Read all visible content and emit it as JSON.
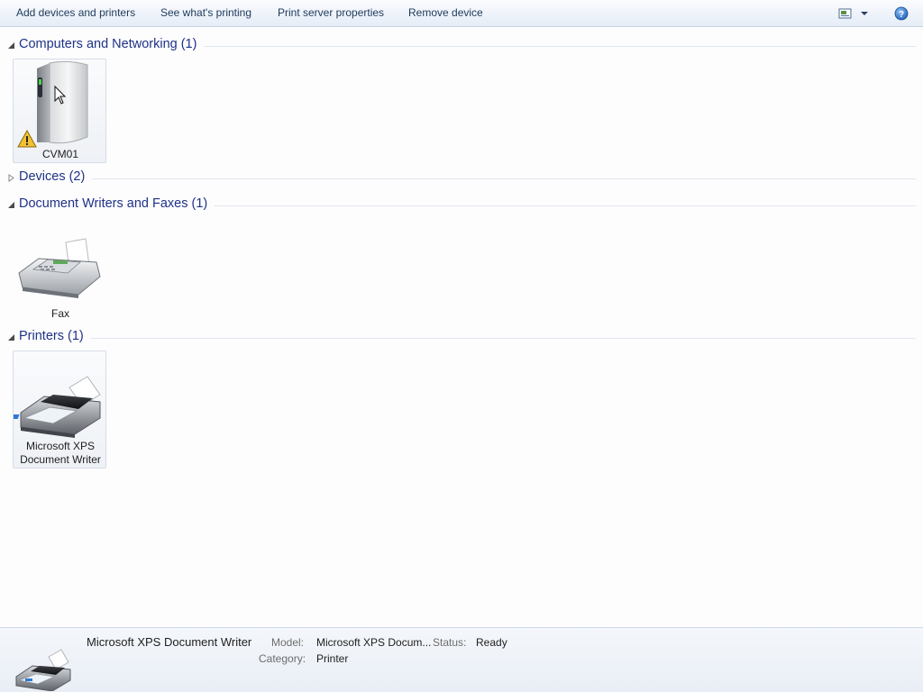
{
  "toolbar": {
    "add_devices": "Add devices and printers",
    "see_printing": "See what's printing",
    "server_props": "Print server properties",
    "remove_device": "Remove device",
    "view_icon": "change-view-icon",
    "help_icon": "help-icon"
  },
  "groups": {
    "computers": {
      "title": "Computers and Networking (1)",
      "expanded": true
    },
    "devices": {
      "title": "Devices (2)",
      "expanded": false
    },
    "writers": {
      "title": "Document Writers and Faxes (1)",
      "expanded": true
    },
    "printers": {
      "title": "Printers (1)",
      "expanded": true
    }
  },
  "items": {
    "cvm01": {
      "label": "CVM01",
      "icon": "computer-tower-icon",
      "warning": true
    },
    "fax": {
      "label": "Fax",
      "icon": "fax-machine-icon"
    },
    "xps_line1": "Microsoft XPS",
    "xps_line2": "Document Writer",
    "xps_icon": "printer-icon"
  },
  "details": {
    "name": "Microsoft XPS Document Writer",
    "model_key": "Model:",
    "model_val": "Microsoft XPS Docum...",
    "status_key": "Status:",
    "status_val": "Ready",
    "category_key": "Category:",
    "category_val": "Printer"
  },
  "colors": {
    "group_title": "#1e3287",
    "command_text": "#1e395b",
    "warning": "#f2c230"
  }
}
